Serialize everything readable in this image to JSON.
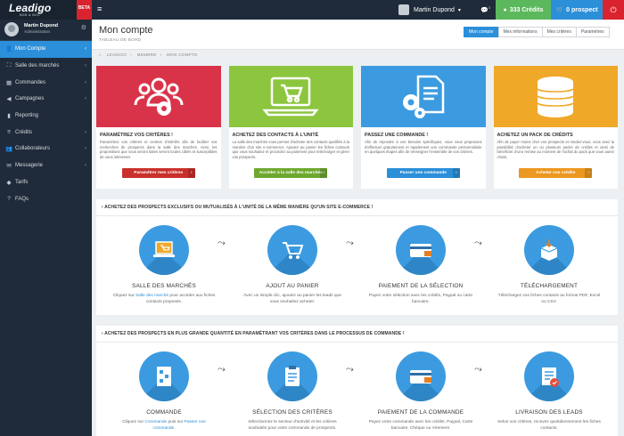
{
  "brand": {
    "logo": "Leadigo",
    "tagline": "B2B & B2C",
    "beta": "BETA"
  },
  "user": {
    "name": "Martin Dupond",
    "role": "Administration"
  },
  "sidebar": {
    "items": [
      {
        "label": "Mon Compte",
        "icon": "user-icon",
        "active": true,
        "chevron": true
      },
      {
        "label": "Salle des marchés",
        "icon": "basket-icon",
        "chevron": true
      },
      {
        "label": "Commandes",
        "icon": "cart-icon",
        "chevron": true
      },
      {
        "label": "Campagnes",
        "icon": "megaphone-icon",
        "chevron": true
      },
      {
        "label": "Reporting",
        "icon": "bar-chart-icon",
        "chevron": false
      },
      {
        "label": "Crédits",
        "icon": "coins-icon",
        "chevron": true
      },
      {
        "label": "Collaborateurs",
        "icon": "users-icon",
        "chevron": true
      },
      {
        "label": "Messagerie",
        "icon": "envelope-icon",
        "chevron": true
      },
      {
        "label": "Tarifs",
        "icon": "tag-icon",
        "chevron": false
      },
      {
        "label": "FAQs",
        "icon": "question-icon",
        "chevron": false
      }
    ]
  },
  "topbar": {
    "user_name": "Martin Dupond",
    "chat_count": "3",
    "credits": "333 Crédits",
    "prospects": "0 prospect"
  },
  "page": {
    "title": "Mon compte",
    "subtitle": "TABLEAU DE BORD",
    "tabs": [
      "Mon compte",
      "Mes informations",
      "Mes critères",
      "Paramètres"
    ]
  },
  "breadcrumb": [
    "LEADIGO",
    "MEMBRE",
    "MON COMPTE"
  ],
  "cards": [
    {
      "title": "PARAMÉTREZ VOS CRITÈRES !",
      "text": "Paramétrez vos critères et centres d'intérêts afin de faciliter vos recherches de prospects dans la salle des marchés. Ainsi, les propositions que vous seront faites seront toutes ciblés et susceptibles de vous intéresser.",
      "button": "Paramétrer mes critères",
      "color": "#d9334a",
      "btn_color": "#c9302c"
    },
    {
      "title": "ACHETEZ DES CONTACTS À L'UNITÉ",
      "text": "La salle des marchés vous permet d'acheter des contacts qualifiés à la manière d'un site e-commerce. Ajoutez au panier les fiches contacts que vous souhaitez et procédez au paiement pour télécharger et gérer vos prospects.",
      "button": "Accéder à la salle des marchés",
      "color": "#8cc63f",
      "btn_color": "#6ea82f"
    },
    {
      "title": "PASSEZ UNE COMMANDE !",
      "text": "Afin de répondre à vos besoins spécifiques, vous vous proposons d'effectuer gratuitement et rapidement une commande personnalisée en quelques étapes afin de renseigner l'ensemble de vos critères.",
      "button": "Passer une commande",
      "color": "#3c9be0",
      "btn_color": "#2b8fd9"
    },
    {
      "title": "ACHETEZ UN PACK DE CRÉDITS",
      "text": "Afin de payer moins cher vos prospects et rendez-vous, vous avez la possibilité d'acheter un ou plusieurs packs de crédits et ainsi de bénéficier d'une remise au moment de l'achat du pack que vous aurez choisi.",
      "button": "Acheter vos crédits",
      "color": "#f0a829",
      "btn_color": "#ec971f"
    }
  ],
  "section1": {
    "title": "ACHETEZ DES PROSPECTS EXCLUSIFS OU MUTUALISÉS À L'UNITÉ DE LA MÊME MANIÈRE QU'UN SITE E-COMMERCE !",
    "steps": [
      {
        "title": "SALLE DES MARCHÉS",
        "text_before": "Cliquez sur ",
        "link": "Salle des marché",
        "text_after": " pour accéder aux fiches contacts proposés."
      },
      {
        "title": "AJOUT AU PANIER",
        "text_before": "Avec un simple clic, ajoutez au panier les leads que vous souhaitez acheter.",
        "link": "",
        "text_after": ""
      },
      {
        "title": "PAIEMENT DE LA SÉLECTION",
        "text_before": "Payez votre sélection avec les crédits, Paypal ou carte bancaire.",
        "link": "",
        "text_after": ""
      },
      {
        "title": "TÉLÉCHARGEMENT",
        "text_before": "Téléchargez vos fiches contacts au format PDF, Excel ou CSV.",
        "link": "",
        "text_after": ""
      }
    ]
  },
  "section2": {
    "title": "ACHETEZ DES PROSPECTS EN PLUS GRANDE QUANTITÉ EN PARAMÉTRANT VOS CRITÈRES DANS LE PROCESSUS DE COMMANDE !",
    "steps": [
      {
        "title": "COMMANDE",
        "text_before": "Cliquez sur ",
        "link": "Commande",
        "text_mid": " puis sur ",
        "link2": "Passer une commande",
        "text_after": "."
      },
      {
        "title": "SÉLECTION DES CRITÈRES",
        "text_before": "Sélectionnez le secteur d'activité et les critères souhaités pour votre commande de prospects."
      },
      {
        "title": "PAIEMENT DE LA COMMANDE",
        "text_before": "Payez votre commande avec les crédits, Paypal, Carte bancaire, Chèque ou Virement."
      },
      {
        "title": "LIVRAISON DES LEADS",
        "text_before": "Selon vos critères, recevez quotidiennement les fiches contacts."
      }
    ]
  }
}
